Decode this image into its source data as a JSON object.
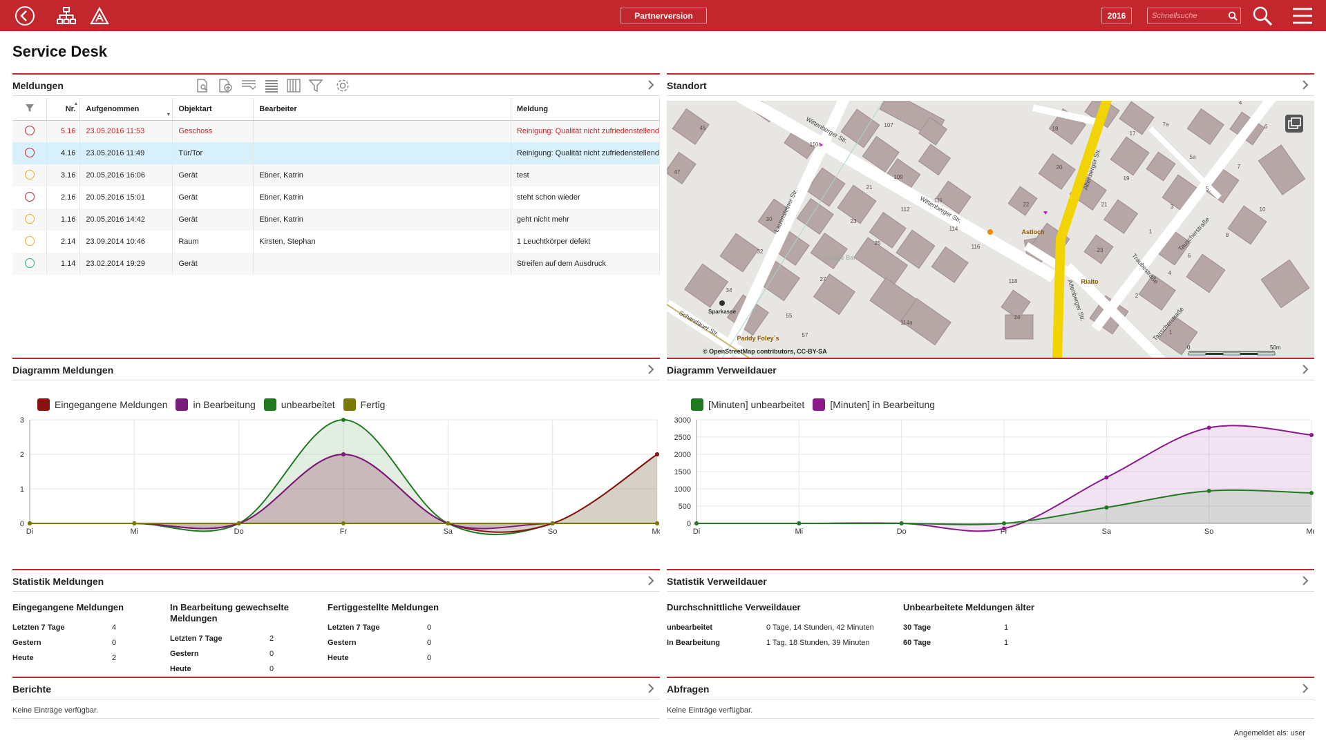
{
  "topbar": {
    "partner_label": "Partnerversion",
    "year": "2016",
    "search_placeholder": "Schnellsuche",
    "bg_color": "#c1272d"
  },
  "page_title": "Service Desk",
  "meldungen": {
    "title": "Meldungen",
    "columns": [
      "",
      "Nr.",
      "Aufgenommen",
      "Objektart",
      "Bearbeiter",
      "Meldung"
    ],
    "rows": [
      {
        "status": "red",
        "nr": "5.16",
        "date": "23.05.2016 11:53",
        "obj": "Geschoss",
        "bearbeiter": "",
        "meldung": "Reinigung: Qualität nicht zufriedenstellend",
        "highlight": "red"
      },
      {
        "status": "red",
        "nr": "4.16",
        "date": "23.05.2016 11:49",
        "obj": "Tür/Tor",
        "bearbeiter": "",
        "meldung": "Reinigung: Qualität nicht zufriedenstellend",
        "highlight": "selected"
      },
      {
        "status": "yellow",
        "nr": "3.16",
        "date": "20.05.2016 16:06",
        "obj": "Gerät",
        "bearbeiter": "Ebner, Katrin",
        "meldung": "test",
        "highlight": ""
      },
      {
        "status": "red",
        "nr": "2.16",
        "date": "20.05.2016 15:01",
        "obj": "Gerät",
        "bearbeiter": "Ebner, Katrin",
        "meldung": "steht schon wieder",
        "highlight": ""
      },
      {
        "status": "yellow",
        "nr": "1.16",
        "date": "20.05.2016 14:42",
        "obj": "Gerät",
        "bearbeiter": "Ebner, Katrin",
        "meldung": "geht nicht mehr",
        "highlight": ""
      },
      {
        "status": "yellow",
        "nr": "2.14",
        "date": "23.09.2014 10:46",
        "obj": "Raum",
        "bearbeiter": "Kirsten, Stephan",
        "meldung": "1 Leuchtkörper defekt",
        "highlight": ""
      },
      {
        "status": "green",
        "nr": "1.14",
        "date": "23.02.2014 19:29",
        "obj": "Gerät",
        "bearbeiter": "",
        "meldung": "Streifen auf dem Ausdruck",
        "highlight": ""
      }
    ],
    "status_colors": {
      "red": "#c1272d",
      "yellow": "#e6b422",
      "green": "#2ab27b"
    }
  },
  "standort": {
    "title": "Standort",
    "streets": [
      "Wittenberger Str.",
      "Wittenberger Str.",
      "Altenberger Str.",
      "Altenberger Str.",
      "Lauensteiner Str.",
      "Schandauer Str.",
      "Traubestraße",
      "Tauscherstraße",
      "Tauscherstraße"
    ],
    "places": [
      "Astloch",
      "Rialto",
      "Sparkasse",
      "Paddy Foley`s",
      "Garage Bar"
    ],
    "house_numbers": [
      "45",
      "47",
      "110c",
      "107",
      "18",
      "109",
      "20",
      "111",
      "21",
      "112",
      "30",
      "23",
      "22",
      "114",
      "32",
      "25",
      "116",
      "118",
      "27",
      "34",
      "55",
      "57",
      "114a",
      "24",
      "17",
      "7a",
      "4",
      "6",
      "5a",
      "7",
      "19",
      "5",
      "21",
      "3",
      "10",
      "1",
      "8",
      "23",
      "6",
      "4",
      "2",
      "1"
    ],
    "attribution": "© OpenStreetMap contributors, CC-BY-SA",
    "scale_start": "0",
    "scale_end": "50m"
  },
  "diagramm_meldungen": {
    "title": "Diagramm Meldungen"
  },
  "diagramm_verweildauer": {
    "title": "Diagramm Verweildauer"
  },
  "chart_data": [
    {
      "type": "area",
      "categories": [
        "Di",
        "Mi",
        "Do",
        "Fr",
        "Sa",
        "So",
        "Mo"
      ],
      "ylim": [
        0,
        3
      ],
      "yticks": [
        "0",
        "1",
        "2",
        "3"
      ],
      "legend_position": "top-left",
      "series": [
        {
          "name": "Eingegangene Meldungen",
          "color": "#8b1010",
          "values": [
            0,
            0,
            0,
            2,
            0,
            0,
            2
          ]
        },
        {
          "name": "in Bearbeitung",
          "color": "#7a1a7a",
          "values": [
            0,
            0,
            0,
            2,
            0,
            0,
            0
          ]
        },
        {
          "name": "unbearbeitet",
          "color": "#1f7a1f",
          "values": [
            0,
            0,
            0,
            3,
            0,
            0,
            2
          ]
        },
        {
          "name": "Fertig",
          "color": "#7a7a00",
          "values": [
            0,
            0,
            0,
            0,
            0,
            0,
            0
          ]
        }
      ]
    },
    {
      "type": "area",
      "categories": [
        "Di",
        "Mi",
        "Do",
        "Fr",
        "Sa",
        "So",
        "Mo"
      ],
      "ylim": [
        0,
        3000
      ],
      "yticks": [
        "0",
        "500",
        "1000",
        "1500",
        "2000",
        "2500",
        "3000"
      ],
      "legend_position": "top-left",
      "series": [
        {
          "name": "[Minuten] unbearbeitet",
          "color": "#1f7a1f",
          "values": [
            0,
            0,
            0,
            0,
            460,
            940,
            880
          ]
        },
        {
          "name": "[Minuten] in Bearbeitung",
          "color": "#8a1a8a",
          "values": [
            0,
            0,
            0,
            -150,
            1330,
            2770,
            2560
          ]
        }
      ]
    }
  ],
  "statistik_meldungen": {
    "title": "Statistik Meldungen",
    "blocks": [
      {
        "heading": "Eingegangene Meldungen",
        "rows": [
          {
            "k": "Letzten 7 Tage",
            "v": "4"
          },
          {
            "k": "Gestern",
            "v": "0"
          },
          {
            "k": "Heute",
            "v": "2"
          }
        ]
      },
      {
        "heading": "In Bearbeitung gewechselte Meldungen",
        "rows": [
          {
            "k": "Letzten 7 Tage",
            "v": "2"
          },
          {
            "k": "Gestern",
            "v": "0"
          },
          {
            "k": "Heute",
            "v": "0"
          }
        ]
      },
      {
        "heading": "Fertiggestellte Meldungen",
        "rows": [
          {
            "k": "Letzten 7 Tage",
            "v": "0"
          },
          {
            "k": "Gestern",
            "v": "0"
          },
          {
            "k": "Heute",
            "v": "0"
          }
        ]
      }
    ]
  },
  "statistik_verweildauer": {
    "title": "Statistik Verweildauer",
    "blocks": [
      {
        "heading": "Durchschnittliche Verweildauer",
        "rows": [
          {
            "k": "unbearbeitet",
            "v": "0 Tage, 14 Stunden, 42 Minuten"
          },
          {
            "k": "In Bearbeitung",
            "v": "1 Tag, 18 Stunden, 39 Minuten"
          }
        ]
      },
      {
        "heading": "Unbearbeitete Meldungen älter",
        "rows": [
          {
            "k": "30 Tage",
            "v": "1"
          },
          {
            "k": "60 Tage",
            "v": "1"
          }
        ]
      }
    ]
  },
  "berichte": {
    "title": "Berichte",
    "empty": "Keine Einträge verfügbar."
  },
  "abfragen": {
    "title": "Abfragen",
    "empty": "Keine Einträge verfügbar."
  },
  "footer": {
    "logged_in": "Angemeldet als: user"
  }
}
